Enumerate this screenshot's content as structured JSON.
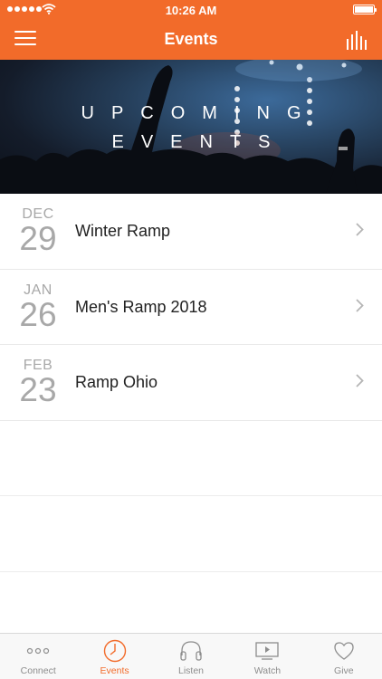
{
  "status_bar": {
    "time": "10:26 AM"
  },
  "nav": {
    "title": "Events"
  },
  "hero": {
    "line1": "UPCOMING",
    "line2": "EVENTS"
  },
  "events": [
    {
      "month": "DEC",
      "day": "29",
      "name": "Winter Ramp"
    },
    {
      "month": "JAN",
      "day": "26",
      "name": "Men's Ramp 2018"
    },
    {
      "month": "FEB",
      "day": "23",
      "name": "Ramp Ohio"
    }
  ],
  "tabs": [
    {
      "label": "Connect",
      "icon": "dots-icon",
      "active": false
    },
    {
      "label": "Events",
      "icon": "clock-icon",
      "active": true
    },
    {
      "label": "Listen",
      "icon": "headphones-icon",
      "active": false
    },
    {
      "label": "Watch",
      "icon": "play-screen-icon",
      "active": false
    },
    {
      "label": "Give",
      "icon": "heart-icon",
      "active": false
    }
  ],
  "colors": {
    "accent": "#f26b2a",
    "tab_inactive": "#8d8d8d",
    "date_gray": "#a8a8a8"
  }
}
